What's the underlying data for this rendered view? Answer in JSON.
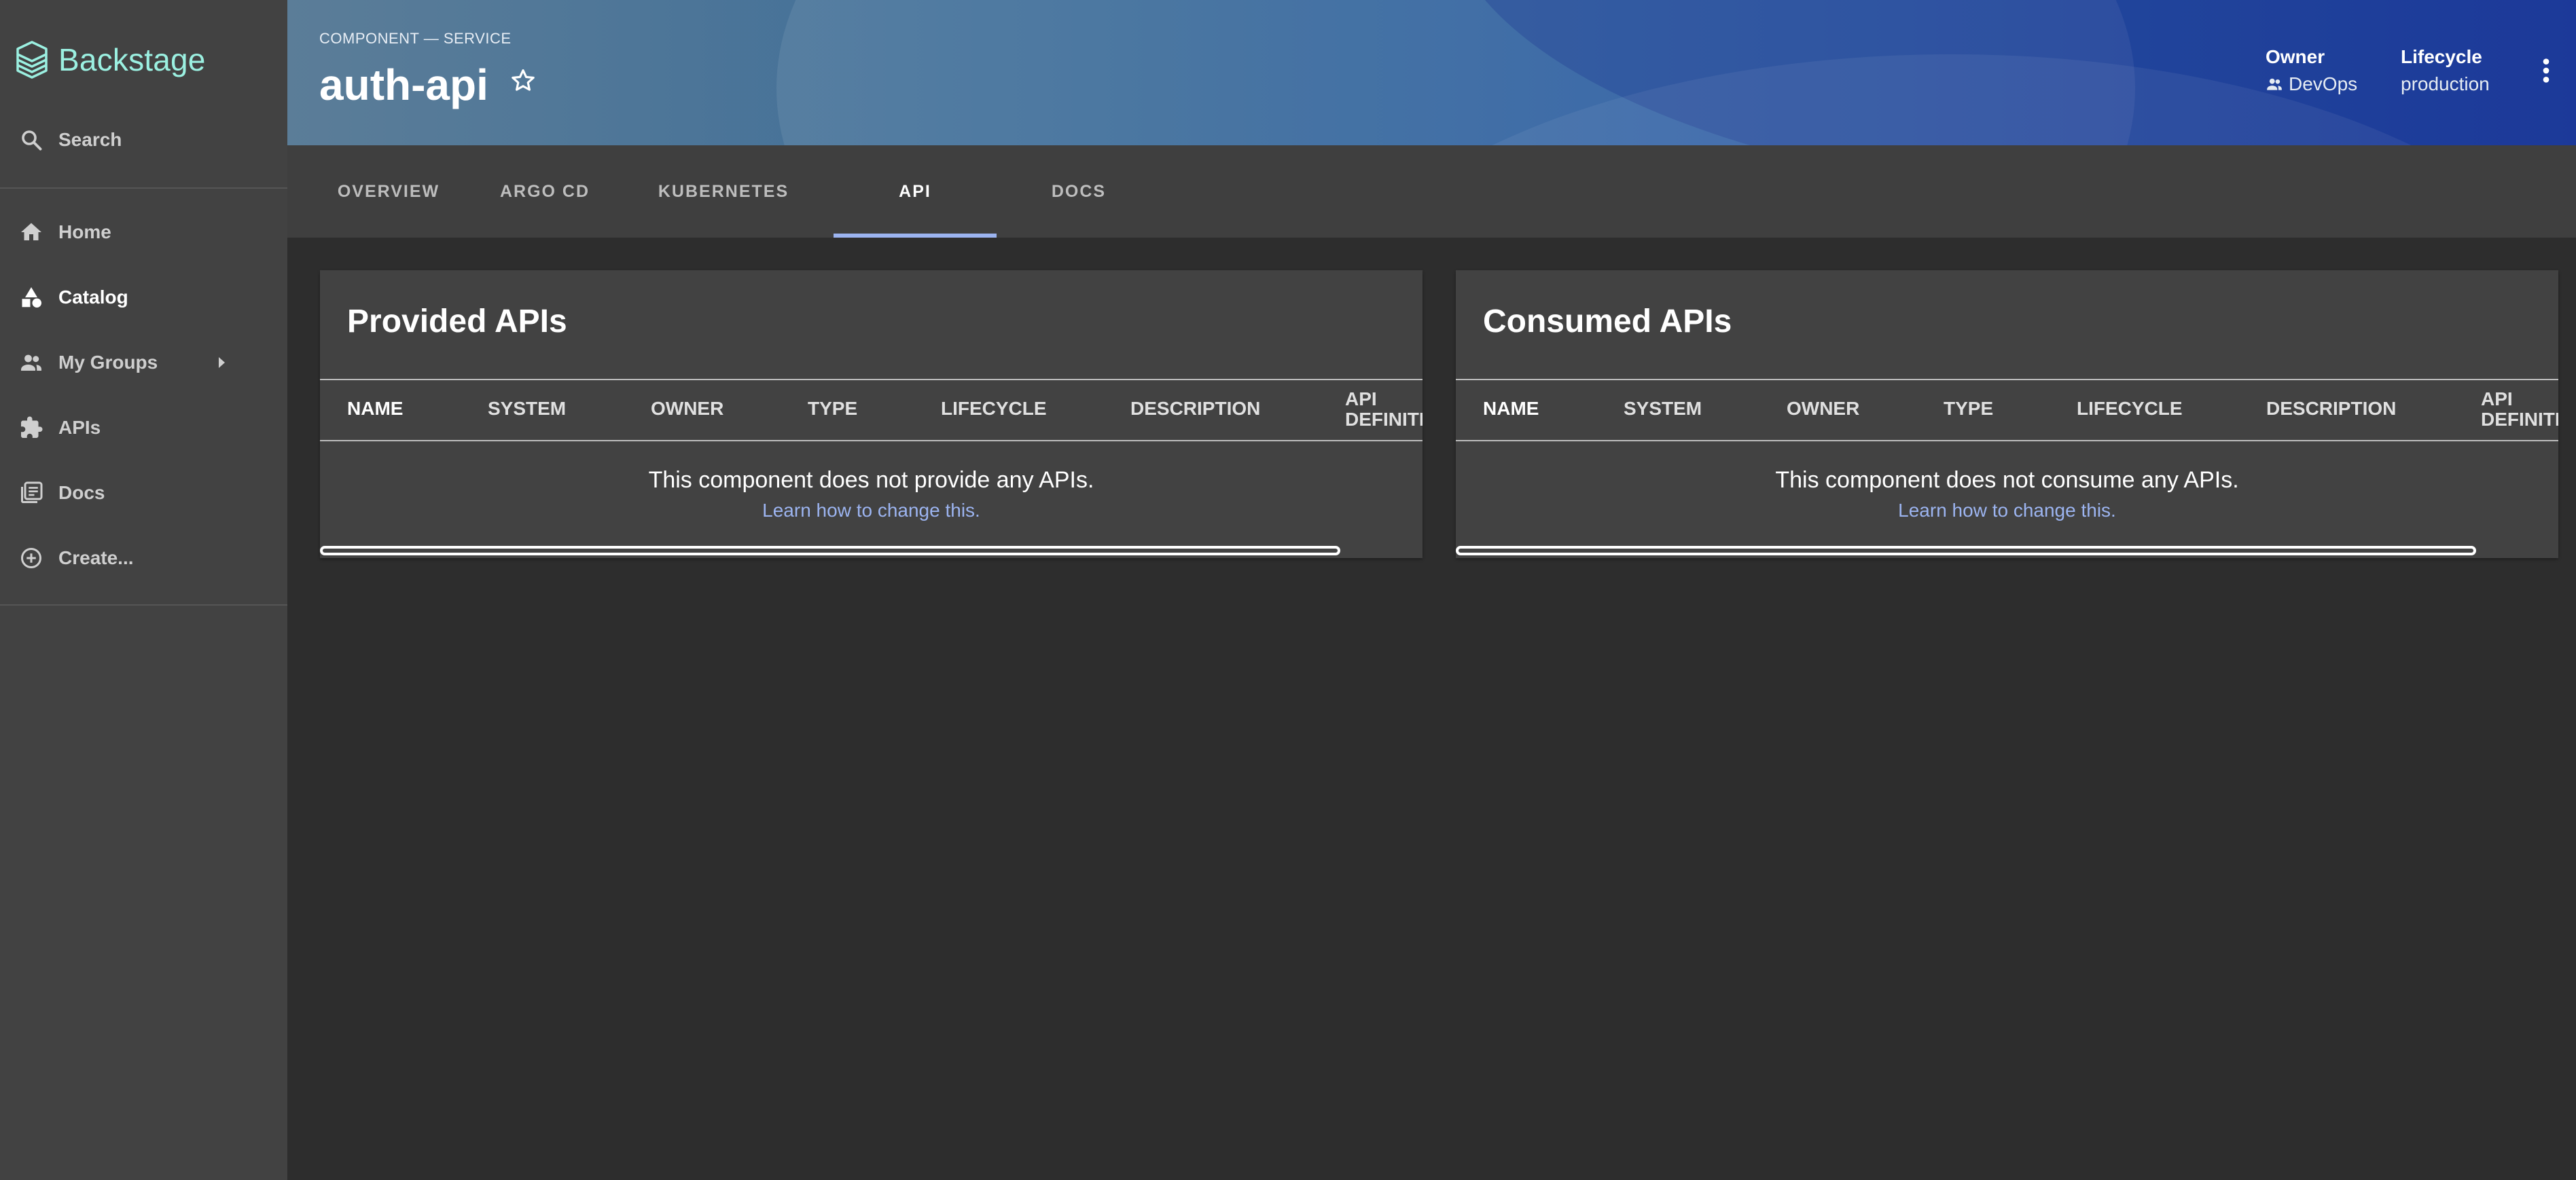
{
  "brand": {
    "name": "Backstage"
  },
  "sidebar": {
    "search_label": "Search",
    "items": [
      {
        "label": "Home",
        "icon": "home-icon"
      },
      {
        "label": "Catalog",
        "icon": "catalog-icon"
      },
      {
        "label": "My Groups",
        "icon": "groups-icon"
      },
      {
        "label": "APIs",
        "icon": "extension-icon"
      },
      {
        "label": "Docs",
        "icon": "docs-icon"
      },
      {
        "label": "Create...",
        "icon": "add-circle-icon"
      }
    ]
  },
  "header": {
    "kind": "COMPONENT — SERVICE",
    "title": "auth-api",
    "owner_label": "Owner",
    "owner_value": "DevOps",
    "lifecycle_label": "Lifecycle",
    "lifecycle_value": "production"
  },
  "tabs": [
    {
      "label": "OVERVIEW"
    },
    {
      "label": "ARGO CD"
    },
    {
      "label": "KUBERNETES"
    },
    {
      "label": "API",
      "active": true
    },
    {
      "label": "DOCS"
    }
  ],
  "provided": {
    "title": "Provided APIs",
    "columns": [
      "NAME",
      "SYSTEM",
      "OWNER",
      "TYPE",
      "LIFECYCLE",
      "DESCRIPTION",
      "API DEFINITION"
    ],
    "empty_message": "This component does not provide any APIs.",
    "link": "Learn how to change this."
  },
  "consumed": {
    "title": "Consumed APIs",
    "columns": [
      "NAME",
      "SYSTEM",
      "OWNER",
      "TYPE",
      "LIFECYCLE",
      "DESCRIPTION",
      "API DEFINITION"
    ],
    "empty_message": "This component does not consume any APIs.",
    "link": "Learn how to change this."
  },
  "colors": {
    "sidebar_bg": "#424242",
    "page_bg": "#2d2d2d",
    "brand_accent": "#9bf0e1",
    "link": "#9cb4f0",
    "tab_indicator": "#9cb4f0"
  }
}
